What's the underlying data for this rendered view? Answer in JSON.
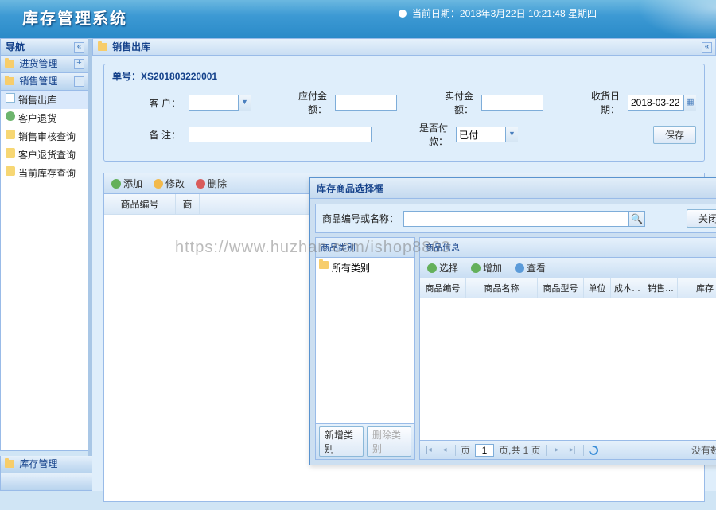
{
  "app": {
    "title": "库存管理系统"
  },
  "datetime": {
    "prefix": "当前日期：",
    "value": "2018年3月22日 10:21:48 星期四"
  },
  "sidebar": {
    "nav_title": "导航",
    "sections": [
      {
        "label": "进货管理",
        "collapsed": true
      },
      {
        "label": "销售管理",
        "collapsed": false
      }
    ],
    "tree": [
      {
        "label": "销售出库",
        "selected": true,
        "icon": "doc"
      },
      {
        "label": "客户退货",
        "icon": "user"
      },
      {
        "label": "销售审核查询",
        "icon": "query"
      },
      {
        "label": "客户退货查询",
        "icon": "query"
      },
      {
        "label": "当前库存查询",
        "icon": "query"
      }
    ],
    "bottom_section": "库存管理"
  },
  "tab": {
    "label": "销售出库"
  },
  "form": {
    "order_no_label": "单号：",
    "order_no": "XS201803220001",
    "labels": {
      "customer": "客  户：",
      "due": "应付金额：",
      "paid_amt": "实付金额：",
      "delivery": "收货日期：",
      "remark": "备  注：",
      "paid_flag": "是否付款："
    },
    "values": {
      "customer": "",
      "due": "",
      "paid_amt": "",
      "delivery": "2018-03-22",
      "remark": "",
      "paid_flag": "已付"
    },
    "save_btn": "保存"
  },
  "main_toolbar": {
    "add": "添加",
    "edit": "修改",
    "delete": "删除"
  },
  "main_columns": {
    "col0": "商品编号",
    "col1": "商"
  },
  "dialog": {
    "title": "库存商品选择框",
    "search_label": "商品编号或名称：",
    "search_value": "",
    "close_btn": "关闭",
    "left_pane": {
      "title": "商品类别",
      "root": "所有类别",
      "add_cat": "新增类别",
      "del_cat": "删除类别"
    },
    "right_pane": {
      "title": "商品信息",
      "toolbar": {
        "select": "选择",
        "add": "增加",
        "view": "查看"
      },
      "columns": [
        "商品编号",
        "商品名称",
        "商品型号",
        "单位",
        "成本…",
        "销售…",
        "库存"
      ],
      "pager": {
        "page_label": "页",
        "page": "1",
        "total_label": "页,共 1 页",
        "no_data": "没有数据"
      }
    }
  },
  "watermark": "https://www.huzhan.com/ishop8803"
}
